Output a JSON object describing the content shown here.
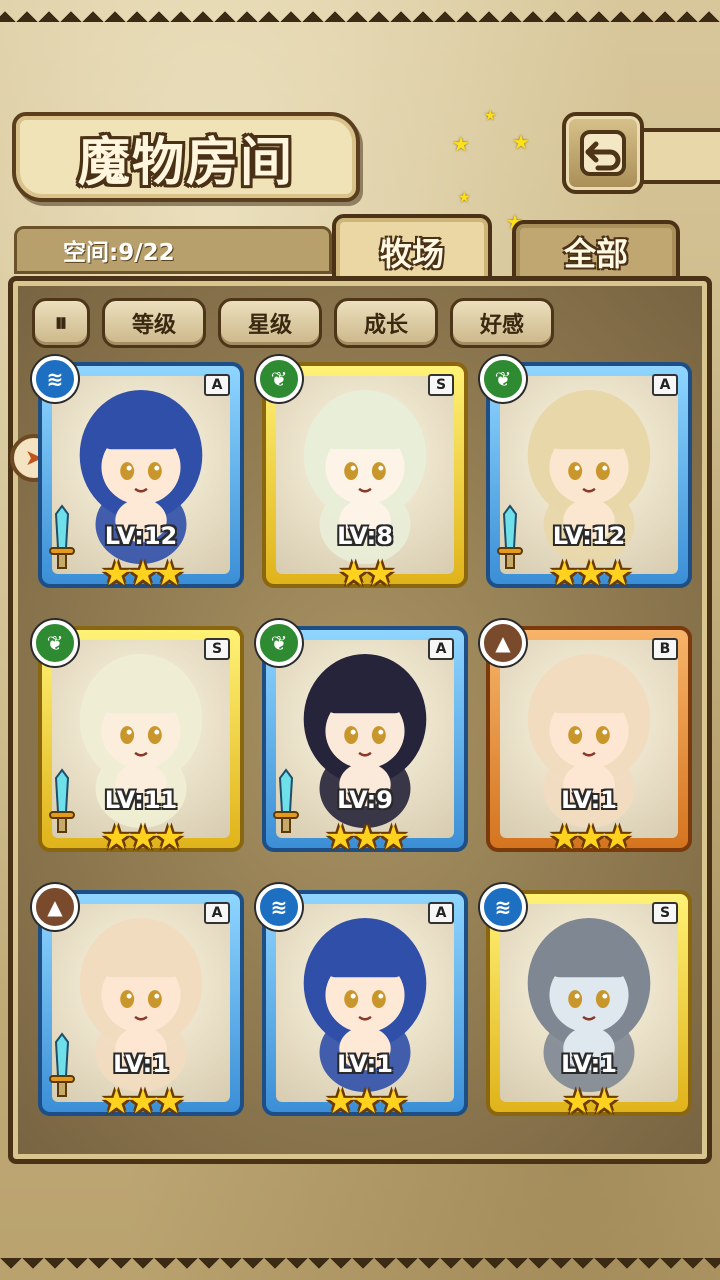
{
  "header": {
    "title": "魔物房间"
  },
  "space": {
    "label": "空间:9/22"
  },
  "tabs": [
    {
      "label": "牧场",
      "active": true
    },
    {
      "label": "全部",
      "active": false
    }
  ],
  "filters": {
    "toggle_icon": "pause-sort-icon",
    "toggle_glyph": "⏸",
    "sort_buttons": [
      "等级",
      "星级",
      "成长",
      "好感"
    ]
  },
  "colors": {
    "frame_A": "#3b8fd6",
    "frame_S": "#e0b31a",
    "frame_B": "#d5741f",
    "water": "#1d6fc2",
    "nature": "#2e8b32",
    "earth": "#7a4a2c"
  },
  "monsters": [
    {
      "rank": "A",
      "element": "water",
      "level": "LV:12",
      "stars": 3,
      "equipped": true,
      "hair": "#2f4fa8",
      "skin": "#fde9d6"
    },
    {
      "rank": "S",
      "element": "nature",
      "level": "LV:8",
      "stars": 2,
      "equipped": false,
      "hair": "#e9eed8",
      "skin": "#fdf3e6"
    },
    {
      "rank": "A",
      "element": "nature",
      "level": "LV:12",
      "stars": 3,
      "equipped": true,
      "hair": "#e8d7a8",
      "skin": "#fbe7cf"
    },
    {
      "rank": "S",
      "element": "nature",
      "level": "LV:11",
      "stars": 3,
      "equipped": true,
      "hair": "#efeed4",
      "skin": "#fbeedd"
    },
    {
      "rank": "A",
      "element": "nature",
      "level": "LV:9",
      "stars": 3,
      "equipped": true,
      "hair": "#26243a",
      "skin": "#fbe9d9"
    },
    {
      "rank": "B",
      "element": "earth",
      "level": "LV:1",
      "stars": 3,
      "equipped": false,
      "hair": "#f2dcc0",
      "skin": "#fde7d2"
    },
    {
      "rank": "A",
      "element": "earth",
      "level": "LV:1",
      "stars": 3,
      "equipped": true,
      "hair": "#f2dcc0",
      "skin": "#fde7d2"
    },
    {
      "rank": "A",
      "element": "water",
      "level": "LV:1",
      "stars": 3,
      "equipped": false,
      "hair": "#2f4fa8",
      "skin": "#fde9d6"
    },
    {
      "rank": "S",
      "element": "water",
      "level": "LV:1",
      "stars": 2,
      "equipped": false,
      "hair": "#7f8793",
      "skin": "#dfe7ef"
    }
  ]
}
